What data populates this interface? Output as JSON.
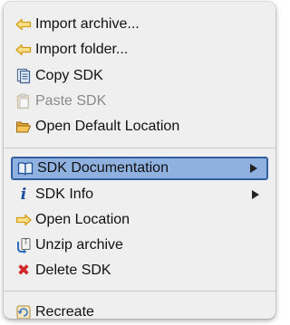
{
  "menu": {
    "items": [
      {
        "label": "Import archive...",
        "icon": "import-arrow-icon"
      },
      {
        "label": "Import folder...",
        "icon": "import-arrow-icon"
      },
      {
        "label": "Copy SDK",
        "icon": "copy-icon"
      },
      {
        "label": "Paste SDK",
        "icon": "paste-icon",
        "disabled": true
      },
      {
        "label": "Open Default Location",
        "icon": "folder-open-icon"
      },
      {
        "label": "SDK Documentation",
        "icon": "book-icon",
        "selected": true,
        "submenu": true
      },
      {
        "label": "SDK Info",
        "icon": "info-icon",
        "submenu": true
      },
      {
        "label": "Open Location",
        "icon": "arrow-right-icon"
      },
      {
        "label": "Unzip archive",
        "icon": "unzip-icon"
      },
      {
        "label": "Delete SDK",
        "icon": "delete-x-icon"
      },
      {
        "label": "Recreate",
        "icon": "recreate-icon"
      }
    ],
    "info_glyph": "i",
    "delete_glyph": "✖"
  },
  "colors": {
    "menu_background": "#efefef",
    "selected_fill": "#8fb1e0",
    "selected_border": "#2f5f9f",
    "disabled_text": "#8a8a8a",
    "icon_yellow": "#f3b52b",
    "delete_red": "#d2262a"
  }
}
